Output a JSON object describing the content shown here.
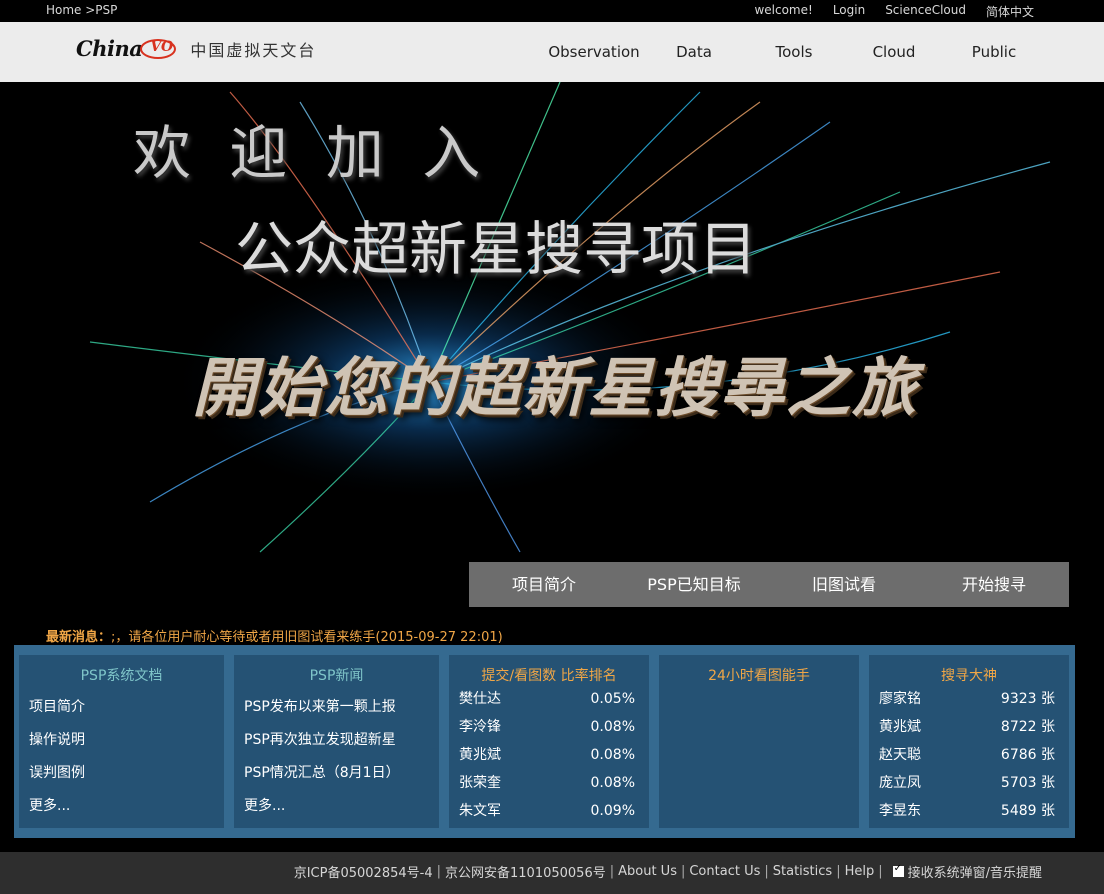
{
  "topbar": {
    "breadcrumb": "Home >PSP",
    "links": [
      "welcome!",
      "Login",
      "ScienceCloud",
      "简体中文"
    ]
  },
  "header": {
    "logo_text": "China-VO",
    "logo_cn": "中国虚拟天文台",
    "nav": [
      "Observation",
      "Data",
      "Tools",
      "Cloud",
      "Public"
    ]
  },
  "banner": {
    "line1": "欢 迎 加 入",
    "line2": "公众超新星搜寻项目",
    "line3": "開始您的超新星搜尋之旅",
    "menu": [
      "项目简介",
      "PSP已知目标",
      "旧图试看",
      "开始搜寻"
    ]
  },
  "news": {
    "label": "最新消息：",
    "text": ";，请各位用户耐心等待或者用旧图试看来练手(2015-09-27 22:01)"
  },
  "panels": {
    "docs": {
      "title": "PSP系统文档",
      "links": [
        "项目简介",
        "操作说明",
        "误判图例",
        "更多..."
      ]
    },
    "newsfeed": {
      "title": "PSP新闻",
      "links": [
        "PSP发布以来第一颗上报",
        "PSP再次独立发现超新星",
        "PSP情况汇总（8月1日）",
        "更多..."
      ]
    },
    "ratio": {
      "title": "提交/看图数 比率排名",
      "rows": [
        {
          "name": "樊仕达",
          "value": "0.05%"
        },
        {
          "name": "李泠锋",
          "value": "0.08%"
        },
        {
          "name": "黄兆斌",
          "value": "0.08%"
        },
        {
          "name": "张荣奎",
          "value": "0.08%"
        },
        {
          "name": "朱文军",
          "value": "0.09%"
        }
      ]
    },
    "viewers24h": {
      "title": "24小时看图能手"
    },
    "masters": {
      "title": "搜寻大神",
      "rows": [
        {
          "name": "廖家铭",
          "value": "9323 张"
        },
        {
          "name": "黄兆斌",
          "value": "8722 张"
        },
        {
          "name": "赵天聪",
          "value": "6786 张"
        },
        {
          "name": "庞立凤",
          "value": "5703 张"
        },
        {
          "name": "李昱东",
          "value": "5489 张"
        }
      ]
    }
  },
  "footer": {
    "links": [
      "京ICP备05002854号-4",
      "京公网安备1101050056号",
      "About Us",
      "Contact Us",
      "Statistics",
      "Help"
    ],
    "checkbox_label": "接收系统弹窗/音乐提醒"
  },
  "colors": {
    "accent_orange": "#f0a646",
    "panel_bg": "#255274",
    "panel_outer": "#356a90",
    "title_teal": "#7fc5c9"
  }
}
